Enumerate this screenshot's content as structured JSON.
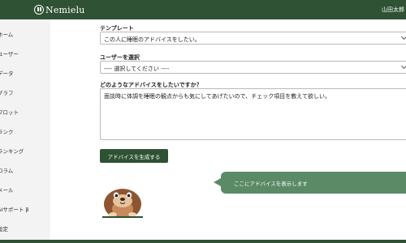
{
  "header": {
    "logo_text": "Nemielu",
    "username": "山田太郎"
  },
  "sidebar": {
    "items": [
      {
        "label": "ホーム"
      },
      {
        "label": "ユーザー"
      },
      {
        "label": "データ"
      },
      {
        "label": "グラフ"
      },
      {
        "label": "プロット"
      },
      {
        "label": "ランク"
      },
      {
        "label": "ランキング"
      },
      {
        "label": "コラム"
      },
      {
        "label": "メール"
      },
      {
        "label": "AIサポート β"
      },
      {
        "label": "設定"
      }
    ]
  },
  "form": {
    "template_label": "テンプレート",
    "template_value": "この人に睡眠のアドバイスをしたい。",
    "user_label": "ユーザーを選択",
    "user_value": "---- 選択してください ----",
    "advice_label": "どのようなアドバイスをしたいですか？",
    "advice_value": "面談時に体調を睡眠の観点からも気にしてあげたいので、チェック項目を教えて欲しい。",
    "generate_button": "アドバイスを生成する"
  },
  "output": {
    "bubble_text": "ここにアドバイスを表示します"
  },
  "colors": {
    "brand_green": "#2e5233",
    "bubble_green": "#5b8a66",
    "sidebar_bg": "#f3f3f3"
  },
  "icons": {
    "logo": "nemielu-logo-icon",
    "select_chevron": "chevron-down-icon",
    "mascot": "mole-mascot-icon"
  }
}
